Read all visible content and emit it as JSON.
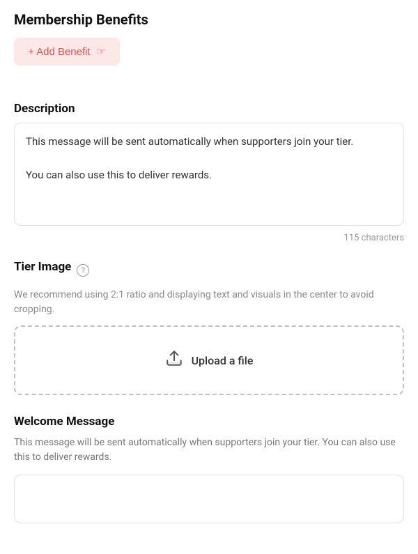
{
  "page": {
    "membership_benefits": {
      "title": "Membership Benefits",
      "add_benefit_label": "+ Add Benefit"
    },
    "description": {
      "label": "Description",
      "textarea_value": "This message will be sent automatically when supporters join your tier.\n\nYou can also use this to deliver rewards.",
      "char_count": "115 characters"
    },
    "tier_image": {
      "label": "Tier Image",
      "help_icon": "?",
      "recommend_text": "We recommend using 2:1 ratio and displaying text and visuals in the center to avoid cropping.",
      "upload_label": "Upload a file",
      "upload_icon": "⬆"
    },
    "welcome_message": {
      "label": "Welcome Message",
      "subtitle": "This message will be sent automatically when supporters join your tier. You can also use this to deliver rewards.",
      "textarea_value": ""
    }
  }
}
